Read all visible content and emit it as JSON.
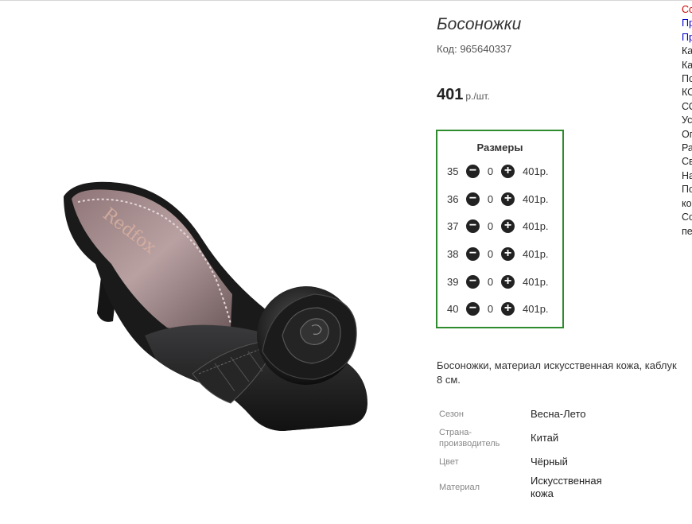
{
  "product": {
    "title": "Босоножки",
    "code": "Код: 965640337",
    "price": "401",
    "price_unit": "р./шт.",
    "brand_insole": "Redfox"
  },
  "sizes": {
    "title": "Размеры",
    "rows": [
      {
        "size": "35",
        "qty": "0",
        "price": "401р."
      },
      {
        "size": "36",
        "qty": "0",
        "price": "401р."
      },
      {
        "size": "37",
        "qty": "0",
        "price": "401р."
      },
      {
        "size": "38",
        "qty": "0",
        "price": "401р."
      },
      {
        "size": "39",
        "qty": "0",
        "price": "401р."
      },
      {
        "size": "40",
        "qty": "0",
        "price": "401р."
      }
    ]
  },
  "description": {
    "line1": "Босоножки, материал искусственная кожа, каблук",
    "line2": "8 см."
  },
  "specs": [
    {
      "label": "Сезон",
      "value": "Весна-Лето"
    },
    {
      "label": "Страна-производитель",
      "label_l1": "Страна-",
      "label_l2": "производитель",
      "value": "Китай"
    },
    {
      "label": "Цвет",
      "value": "Чёрный"
    },
    {
      "label": "Материал",
      "value": "Искусственная кожа",
      "value_l1": "Искусственная",
      "value_l2": "кожа"
    }
  ],
  "sidebar_cut": [
    {
      "text": "Со",
      "color": "red"
    },
    {
      "text": "Пр",
      "color": "blue"
    },
    {
      "text": "Пр",
      "color": "blue"
    },
    {
      "text": "Ка",
      "color": "black"
    },
    {
      "text": "Ка",
      "color": "black"
    },
    {
      "text": "По",
      "color": "black"
    },
    {
      "text": "КО",
      "color": "black"
    },
    {
      "text": "СО",
      "color": "black"
    },
    {
      "text": "Ус",
      "color": "black"
    },
    {
      "text": "Оп",
      "color": "black"
    },
    {
      "text": "Ра",
      "color": "black"
    },
    {
      "text": "Св",
      "color": "black"
    },
    {
      "text": "На",
      "color": "black"
    },
    {
      "text": "По",
      "color": "black"
    },
    {
      "text": "ко",
      "color": "black"
    },
    {
      "text": "Со",
      "color": "black"
    },
    {
      "text": "пе",
      "color": "black"
    }
  ],
  "colors": {
    "sizes_border": "#2e8b2e",
    "sidebar_red": "#d00000",
    "sidebar_blue": "#0000c8"
  }
}
